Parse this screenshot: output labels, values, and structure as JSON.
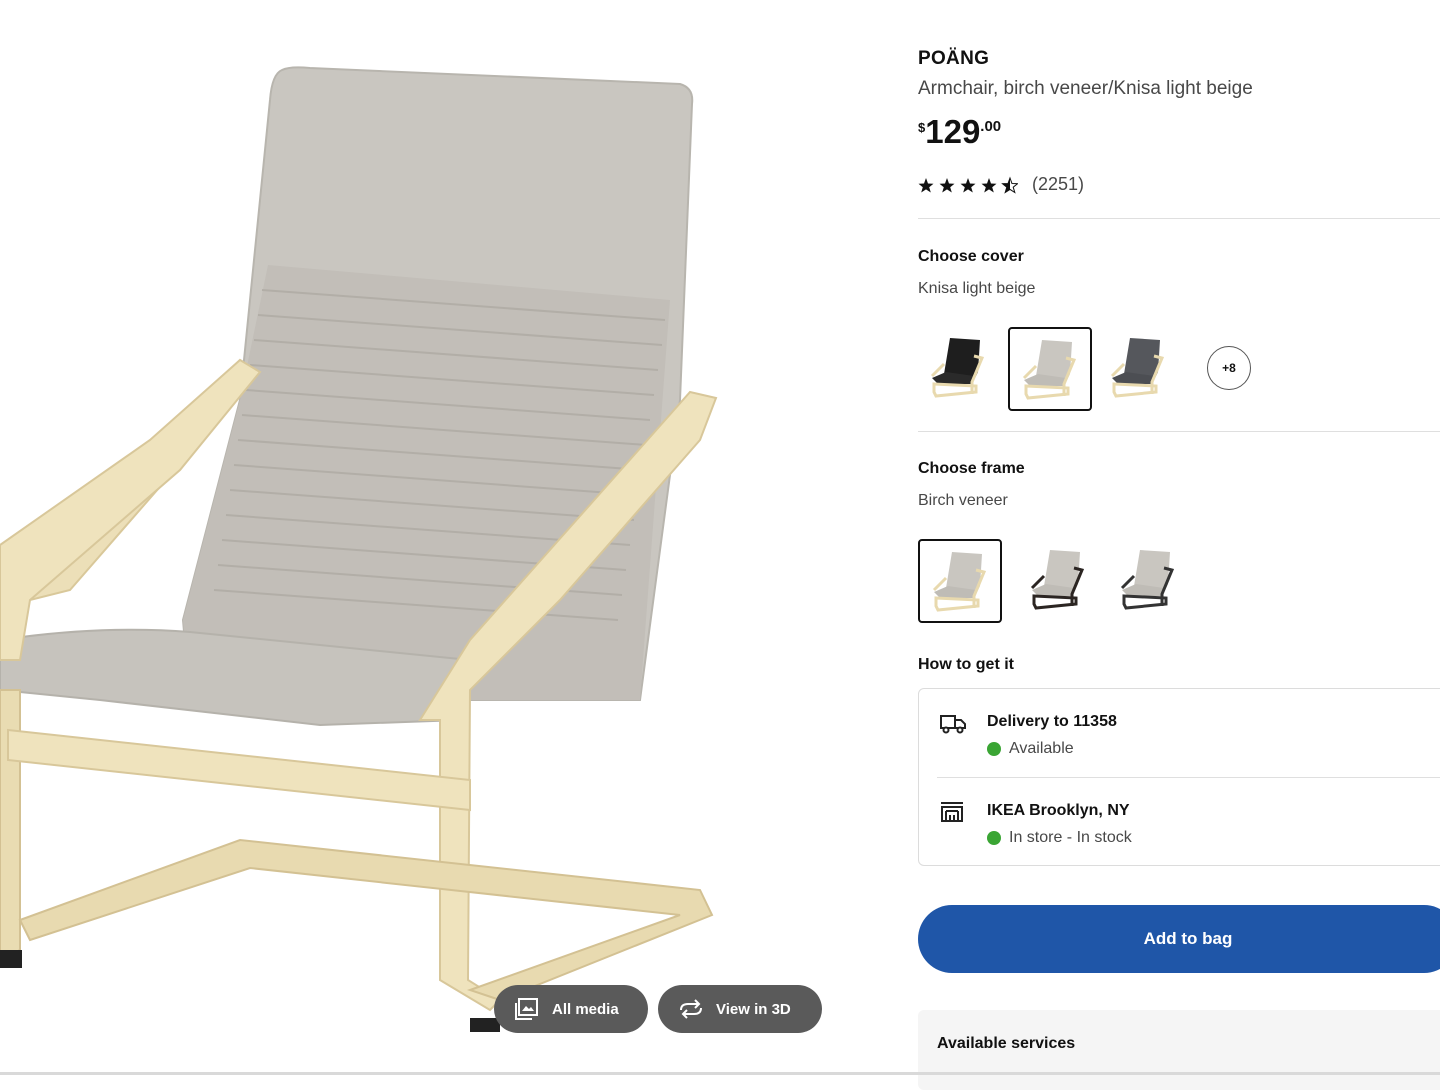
{
  "product": {
    "name": "POÄNG",
    "description": "Armchair, birch veneer/Knisa light beige",
    "price": {
      "currency": "$",
      "whole": "129",
      "decimal": ".00"
    },
    "rating": {
      "stars": 4.5,
      "count": "(2251)"
    }
  },
  "media_buttons": {
    "all_media": "All media",
    "view_3d": "View in 3D"
  },
  "cover": {
    "heading": "Choose cover",
    "selected": "Knisa light beige",
    "options": [
      "black cover",
      "light beige cover",
      "dark grey cover"
    ],
    "selected_index": 1,
    "more_label": "+8"
  },
  "frame": {
    "heading": "Choose frame",
    "selected": "Birch veneer",
    "options": [
      "birch veneer frame",
      "black-brown frame",
      "dark frame"
    ],
    "selected_index": 0
  },
  "how_to_get": {
    "heading": "How to get it",
    "delivery": {
      "title": "Delivery to 11358",
      "status": "Available",
      "icon": "truck-icon"
    },
    "store": {
      "title": "IKEA Brooklyn, NY",
      "status": "In store - In stock",
      "icon": "store-icon"
    }
  },
  "cta": {
    "add_to_bag": "Add to bag"
  },
  "services": {
    "heading": "Available services"
  },
  "colors": {
    "primary_blue": "#1f56a8",
    "status_green": "#3aa534",
    "media_button_grey": "#5a5a5a"
  }
}
